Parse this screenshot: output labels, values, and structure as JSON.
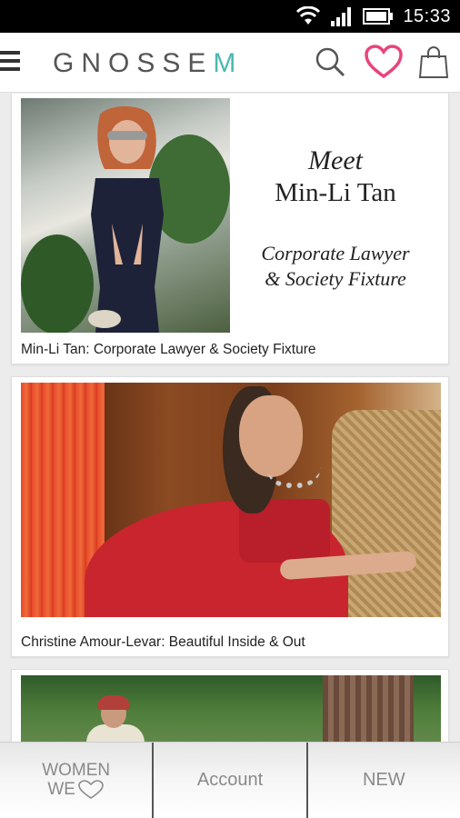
{
  "status_bar": {
    "time": "15:33",
    "icons": [
      "wifi-icon",
      "signal-icon",
      "battery-icon"
    ]
  },
  "app_bar": {
    "logo_main": "GNOSSE",
    "logo_accent": "M",
    "accent_color": "#4bb8b0",
    "heart_color": "#e8457a",
    "icons": [
      "menu-icon",
      "search-icon",
      "heart-icon",
      "shopping-bag-icon"
    ]
  },
  "feed": {
    "cards": [
      {
        "title": "Min-Li Tan: Corporate Lawyer & Society Fixture",
        "image_text": {
          "meet": "Meet",
          "name": "Min-Li Tan",
          "role_line1": "Corporate Lawyer",
          "role_line2": "& Society Fixture"
        }
      },
      {
        "title": "Christine Amour-Levar: Beautiful Inside & Out"
      },
      {
        "title": ""
      }
    ]
  },
  "bottom_nav": {
    "women_line1": "WOMEN",
    "women_line2": "WE",
    "account": "Account",
    "new": "NEW"
  }
}
